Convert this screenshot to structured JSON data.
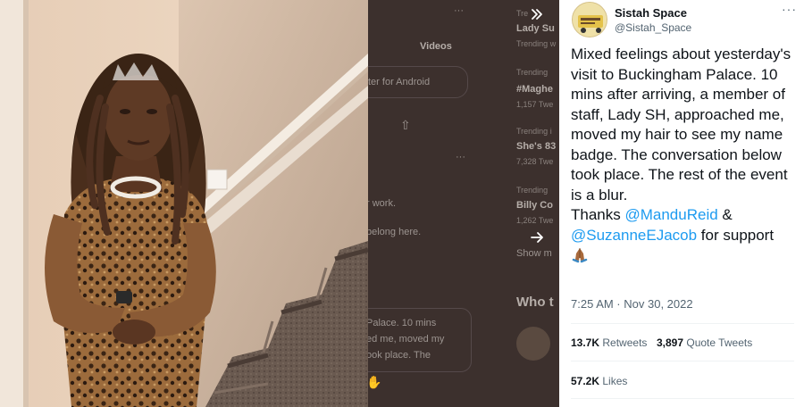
{
  "lightbox": {
    "collapse_icon": "double-chevron-right-icon",
    "next_icon": "arrow-right-icon"
  },
  "tweet": {
    "display_name": "Sistah Space",
    "handle": "@Sistah_Space",
    "more_label": "···",
    "text_1": "Mixed feelings about yesterday's visit to Buckingham Palace. 10 mins after arriving, a member of staff, Lady SH, approached me, moved my hair to see my name badge. The conversation below took place. The rest of the event is a blur.",
    "text_2": "Thanks ",
    "mention_1": "@ManduReid",
    "text_3": " & ",
    "mention_2": "@SuzanneEJacob",
    "text_4": " for support",
    "emoji": "folded-hands-emoji",
    "timestamp": "7:25 AM · Nov 30, 2022",
    "retweets_count": "13.7K",
    "retweets_label": "Retweets",
    "quote_count": "3,897",
    "quote_label": "Quote Tweets",
    "likes_count": "57.2K",
    "likes_label": "Likes"
  },
  "background": {
    "trend_1_title": "Lady Su",
    "trend_1_meta": "Trending w",
    "trend_2_meta": "Trending",
    "trend_2_title": "#Maghe",
    "trend_2_count": "1,157 Twe",
    "trend_3_meta": "Trending i",
    "trend_3_title": "She's 83",
    "trend_3_count": "7,328 Twe",
    "trend_4_meta": "Trending",
    "trend_4_title": "Billy Co",
    "trend_4_count": "1,262 Twe",
    "show_more": "Show m",
    "who_to_follow": "Who t",
    "videos_tab": "Videos",
    "android_text": "ter for Android",
    "work_text": "r work.",
    "belong_text": "belong here.",
    "quote_line_1": "Palace. 10 mins",
    "quote_line_2": "ed me, moved my",
    "quote_line_3": "ook place. The",
    "more_dots": "···"
  }
}
